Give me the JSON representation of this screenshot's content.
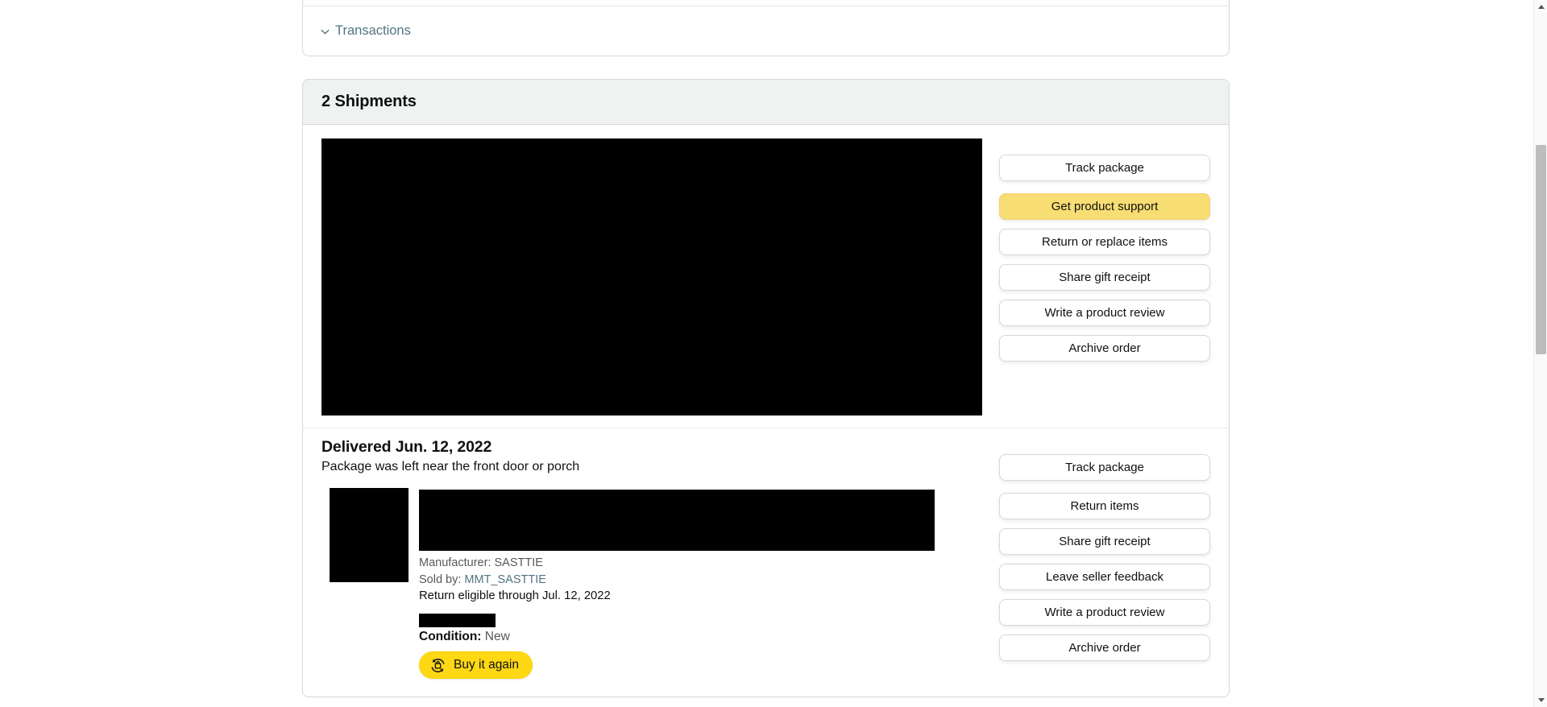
{
  "transactions": {
    "label": "Transactions",
    "chevron_icon": "chevron-down-icon"
  },
  "shipments_card": {
    "header_title": "2 Shipments"
  },
  "shipment_1": {
    "actions": [
      {
        "label": "Track package",
        "style": "default"
      },
      {
        "label": "Get product support",
        "style": "primary"
      },
      {
        "label": "Return or replace items",
        "style": "default"
      },
      {
        "label": "Share gift receipt",
        "style": "default"
      },
      {
        "label": "Write a product review",
        "style": "default"
      },
      {
        "label": "Archive order",
        "style": "default"
      }
    ]
  },
  "shipment_2": {
    "status_title": "Delivered Jun. 12, 2022",
    "status_subtitle": "Package was left near the front door or porch",
    "manufacturer": "Manufacturer: SASTTIE",
    "sold_by_prefix": "Sold by: ",
    "sold_by_seller": "MMT_SASTTIE",
    "return_eligible": "Return eligible through Jul. 12, 2022",
    "condition_label": "Condition:",
    "condition_value": "New",
    "buy_again_label": "Buy it again",
    "buy_again_icon": "buy-it-again-icon",
    "actions": [
      {
        "label": "Track package",
        "style": "default"
      },
      {
        "label": "Return items",
        "style": "default"
      },
      {
        "label": "Share gift receipt",
        "style": "default"
      },
      {
        "label": "Leave seller feedback",
        "style": "default"
      },
      {
        "label": "Write a product review",
        "style": "default"
      },
      {
        "label": "Archive order",
        "style": "default"
      }
    ]
  },
  "colors": {
    "link": "#527480",
    "primary_button": "#f7dd73",
    "buy_again_button": "#ffd814",
    "header_background": "#f0f2f2",
    "border": "#d5d9d9",
    "text": "#0f1111",
    "muted_text": "#565959"
  }
}
